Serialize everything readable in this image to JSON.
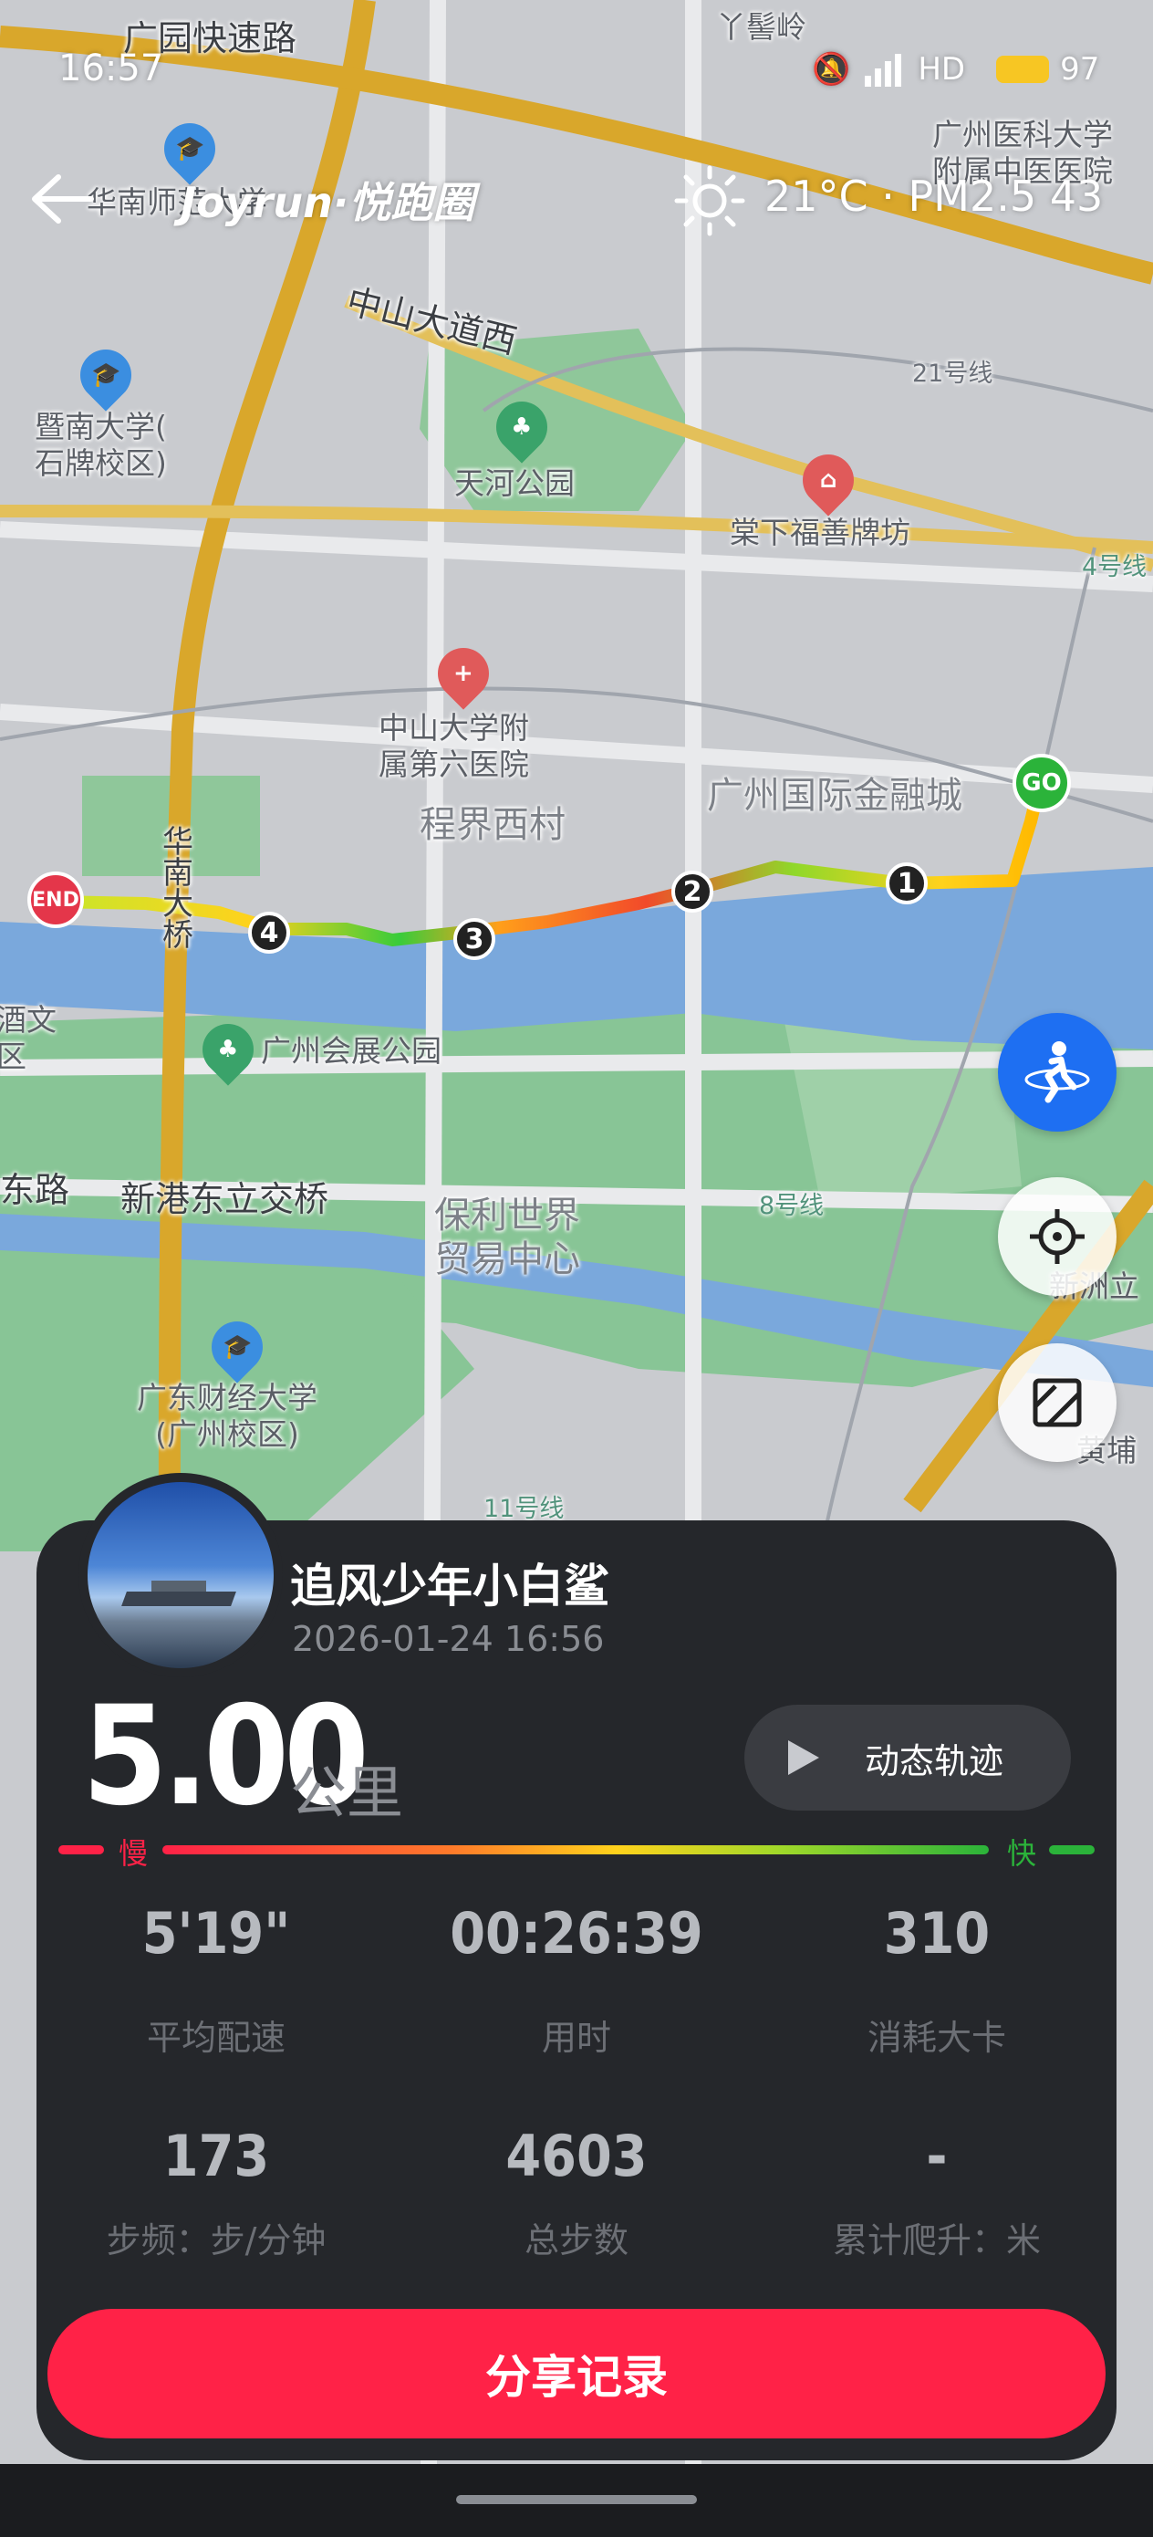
{
  "status_bar": {
    "time": "16:57",
    "hd": "HD",
    "battery": "97"
  },
  "header": {
    "brand": "Joyrun·悦跑圈",
    "weather": "21°C · PM2.5 43"
  },
  "map": {
    "labels": {
      "guangyuan": "广园快速路",
      "yajiling": "丫髻岭",
      "yike": "广州医科大学\n附属中医医院",
      "huanan_normal": "华南师范大学",
      "zhongshan_road": "中山大道西",
      "line21": "21号线",
      "jinan": "暨南大学(\n石牌校区)",
      "tianhe_park": "天河公园",
      "tangxia": "棠下福善牌坊",
      "line4": "4号线",
      "zsu6": "中山大学附\n属第六医院",
      "chengjie": "程界西村",
      "ifc": "广州国际金融城",
      "huanan_bridge": "华\n南\n大\n桥",
      "expo_park": "广州会展公园",
      "culture": "酒文\n区",
      "east_road": "东路",
      "xingang": "新港东立交桥",
      "poly": "保利世界\n贸易中心",
      "line8": "8号线",
      "xinzhou": "新洲立",
      "gdufe": "广东财经大学\n(广州校区)",
      "huangpu": "黄埔",
      "line11": "11号线"
    },
    "route": {
      "start_label": "GO",
      "end_label": "END",
      "km_markers": [
        "1",
        "2",
        "3",
        "4"
      ]
    }
  },
  "panel": {
    "username": "追风少年小白鲨",
    "datetime": "2026-01-24 16:56",
    "distance": "5.00",
    "distance_unit": "公里",
    "dynamic_track": "动态轨迹",
    "slow": "慢",
    "fast": "快",
    "stats": [
      {
        "value": "5'19\"",
        "label": "平均配速"
      },
      {
        "value": "00:26:39",
        "label": "用时"
      },
      {
        "value": "310",
        "label": "消耗大卡"
      },
      {
        "value": "173",
        "label": "步频：步/分钟"
      },
      {
        "value": "4603",
        "label": "总步数"
      },
      {
        "value": "-",
        "label": "累计爬升：米"
      }
    ],
    "share_button": "分享记录"
  },
  "colors": {
    "accent_red": "#ff2247",
    "panel_bg": "#25272b",
    "blue_button": "#1e6ff2",
    "go_green": "#2bb33a"
  }
}
